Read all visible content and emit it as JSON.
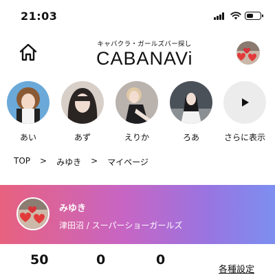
{
  "status_bar": {
    "time": "21:03",
    "battery_level": 0.55
  },
  "header": {
    "logo_tagline": "キャバクラ・ガールズバー探し",
    "logo_text": "CABANAVi"
  },
  "stories": [
    {
      "label": "あい"
    },
    {
      "label": "あず"
    },
    {
      "label": "えりか"
    },
    {
      "label": "ろあ"
    },
    {
      "label": "さらに表示"
    }
  ],
  "breadcrumb": [
    "TOP",
    ">",
    "みゆき",
    ">",
    "マイページ"
  ],
  "profile": {
    "name": "みゆき",
    "area_shop": "津田沼 / スーパーショーガールズ"
  },
  "stats": [
    "50",
    "0",
    "0"
  ],
  "settings_label": "各種設定",
  "colors": {
    "banner_gradient": [
      "#e8627f",
      "#c765c4",
      "#9a74e0",
      "#7c8ff0"
    ],
    "story_bg": "#ececec"
  }
}
